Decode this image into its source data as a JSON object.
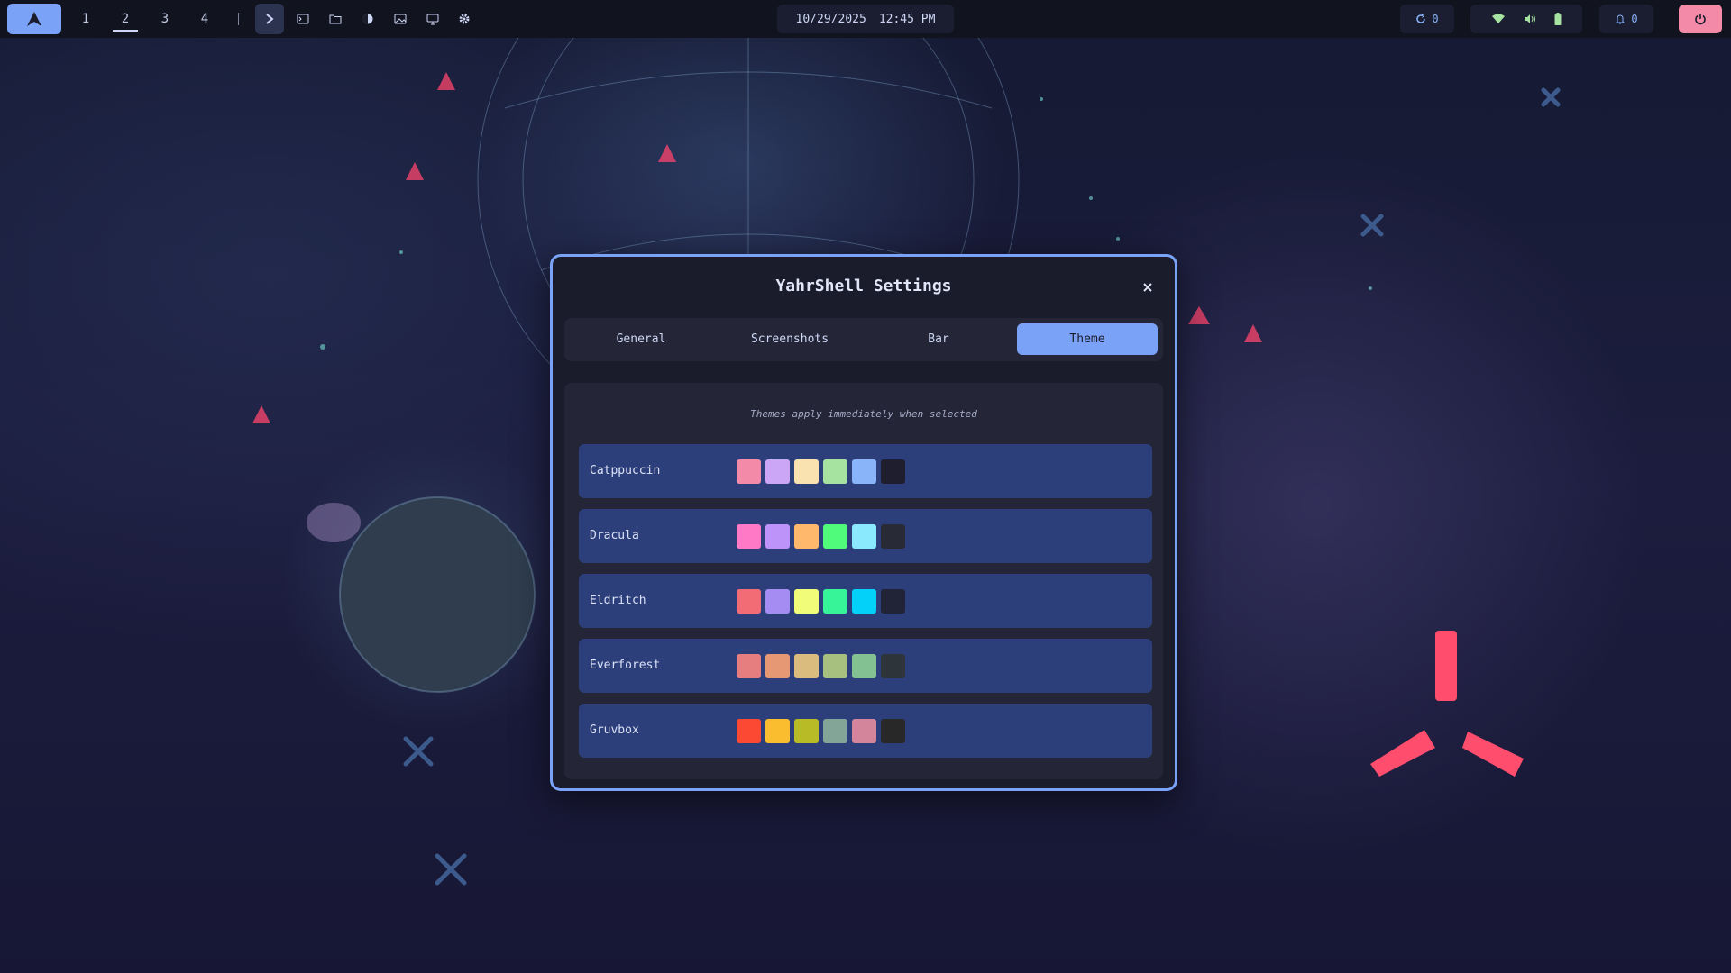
{
  "taskbar": {
    "workspaces": [
      "1",
      "2",
      "3",
      "4"
    ],
    "active_workspace": "2",
    "launchers": [
      "chevron-right-icon",
      "terminal-icon",
      "folder-icon",
      "color-picker-icon",
      "image-icon",
      "display-icon",
      "gear-icon"
    ],
    "date": "10/29/2025",
    "time": "12:45 PM",
    "updates_count": "0",
    "notifications_count": "0",
    "colors": {
      "accent": "#7aa2f7",
      "wifi": "#a6e3a1",
      "power": "#f38ba8",
      "bar_bg": "#11131f"
    }
  },
  "dialog": {
    "title": "YahrShell Settings",
    "tabs": [
      "General",
      "Screenshots",
      "Bar",
      "Theme"
    ],
    "active_tab": "Theme",
    "hint": "Themes apply immediately when selected",
    "themes": [
      {
        "name": "Catppuccin",
        "colors": [
          "#f38ba8",
          "#cba6f7",
          "#f9e2af",
          "#a6e3a1",
          "#89b4fa",
          "#1e1e2e"
        ]
      },
      {
        "name": "Dracula",
        "colors": [
          "#ff79c6",
          "#bd93f9",
          "#ffb86c",
          "#50fa7b",
          "#8be9fd",
          "#282a36"
        ]
      },
      {
        "name": "Eldritch",
        "colors": [
          "#f16c75",
          "#a48cf2",
          "#f1fc79",
          "#37f499",
          "#04d1f9",
          "#212337"
        ]
      },
      {
        "name": "Everforest",
        "colors": [
          "#e67e80",
          "#e69875",
          "#dbbc7f",
          "#a7c080",
          "#83c092",
          "#2d353b"
        ]
      },
      {
        "name": "Gruvbox",
        "colors": [
          "#fb4934",
          "#fabd2f",
          "#b8bb26",
          "#83a598",
          "#d3869b",
          "#282828"
        ]
      }
    ]
  }
}
